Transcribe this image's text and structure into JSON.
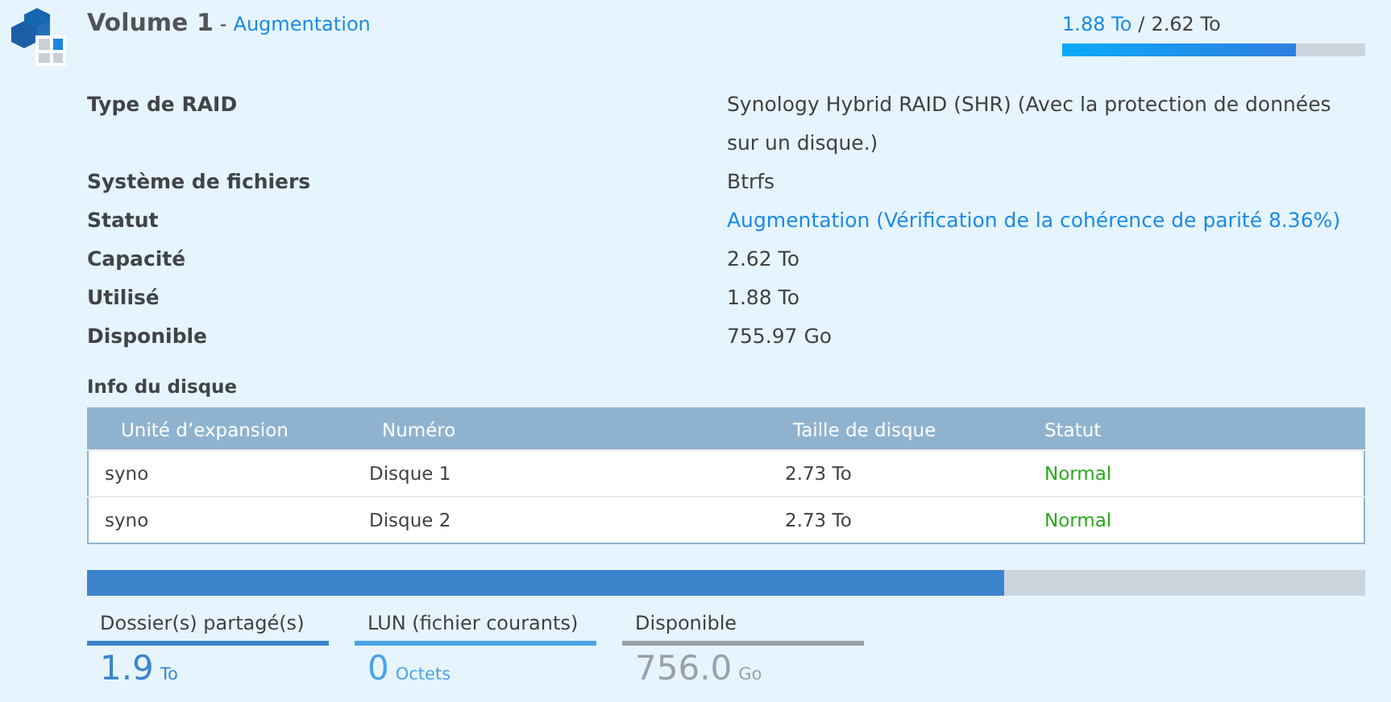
{
  "header": {
    "title": "Volume 1",
    "separator": "-",
    "state": "Augmentation",
    "used": "1.88 To",
    "slash": "/",
    "total": "2.62 To",
    "level": 0.77
  },
  "details": [
    {
      "label": "Type de RAID",
      "value": "Synology Hybrid RAID (SHR) (Avec la protection de données sur un disque.)",
      "kind": "text"
    },
    {
      "label": "Système de fichiers",
      "value": "Btrfs",
      "kind": "text"
    },
    {
      "label": "Statut",
      "value": "Augmentation (Vérification de la cohérence de parité 8.36%)",
      "kind": "link"
    },
    {
      "label": "Capacité",
      "value": "2.62 To",
      "kind": "text"
    },
    {
      "label": "Utilisé",
      "value": "1.88 To",
      "kind": "text"
    },
    {
      "label": "Disponible",
      "value": "755.97 Go",
      "kind": "text"
    }
  ],
  "disk_info": {
    "title": "Info du disque",
    "columns": [
      "Unité d’expansion",
      "Numéro",
      "Taille de disque",
      "Statut"
    ],
    "rows": [
      [
        "syno",
        "Disque 1",
        "2.73 To",
        "Normal"
      ],
      [
        "syno",
        "Disque 2",
        "2.73 To",
        "Normal"
      ]
    ]
  },
  "usage": {
    "segments": [
      {
        "label": "Dossier(s) partagé(s)",
        "value": "1.9",
        "unit": "To",
        "color": "#3b84cc",
        "level": 0.718
      },
      {
        "label": "LUN (fichier courants)",
        "value": "0",
        "unit": "Octets",
        "color": "#4aa3e8"
      },
      {
        "label": "Disponible",
        "value": "756.0",
        "unit": "Go",
        "color": "#9aa0a8"
      }
    ]
  }
}
